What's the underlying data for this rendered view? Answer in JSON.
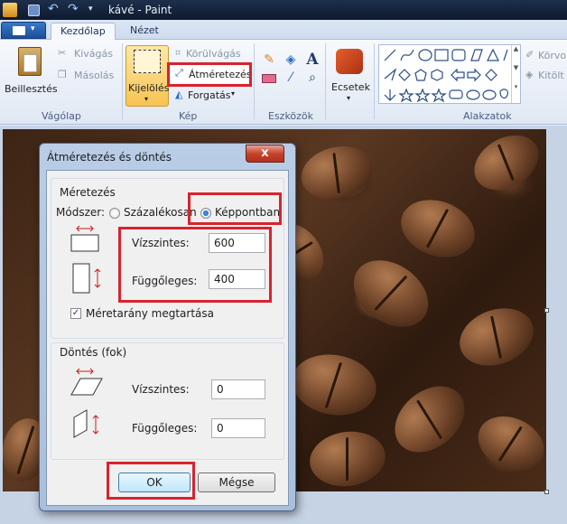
{
  "window": {
    "title": "kávé - Paint"
  },
  "tabs": [
    {
      "label": "Kezdőlap"
    },
    {
      "label": "Nézet"
    }
  ],
  "ribbon": {
    "clipboard": {
      "paste": "Beillesztés",
      "cut": "Kivágás",
      "copy": "Másolás",
      "group": "Vágólap"
    },
    "image": {
      "select": "Kijelölés",
      "crop": "Körülvágás",
      "resize": "Átméretezés",
      "rotate": "Forgatás",
      "group": "Kép"
    },
    "tools": {
      "group": "Eszközök"
    },
    "brushes": {
      "label": "Ecsetek"
    },
    "shapes": {
      "group": "Alakzatok",
      "outline": "Körvo",
      "fill": "Kitölt"
    }
  },
  "dialog": {
    "title": "Átméretezés és döntés",
    "close": "x",
    "resize_section": "Méretezés",
    "method_label": "Módszer:",
    "option_percent": "Százalékosan",
    "option_pixels": "Képpontban",
    "horizontal_label": "Vízszintes:",
    "horizontal_value": "600",
    "vertical_label": "Függőleges:",
    "vertical_value": "400",
    "keep_ratio": "Méretarány megtartása",
    "skew_section": "Döntés (fok)",
    "skew_horizontal_label": "Vízszintes:",
    "skew_horizontal_value": "0",
    "skew_vertical_label": "Függőleges:",
    "skew_vertical_value": "0",
    "ok": "OK",
    "cancel": "Mégse"
  },
  "colors": {
    "highlight": "#d8232f",
    "ribbon": "#dfe8f4",
    "file_button": "#1b4f99"
  }
}
